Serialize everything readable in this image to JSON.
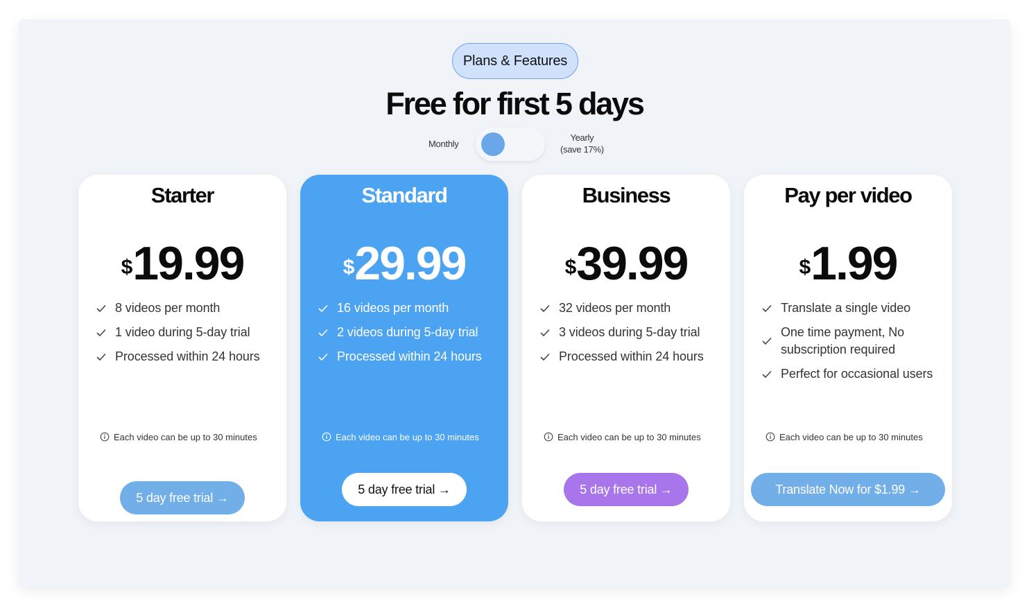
{
  "badge": "Plans & Features",
  "headline": "Free for first 5 days",
  "billing": {
    "monthly_label": "Monthly",
    "yearly_label": "Yearly",
    "yearly_note": "(save 17%)",
    "selected": "Monthly"
  },
  "colors": {
    "page_bg": "#f0f3f7",
    "accent_blue": "#4ba3f2",
    "button_blue": "#72aee8",
    "button_purple": "#a876ea",
    "badge_bg": "#cfe1fb"
  },
  "plans": [
    {
      "name": "Starter",
      "currency": "$",
      "price": "19.99",
      "features": [
        "8 videos per month",
        "1 video during  5-day trial",
        "Processed within 24 hours"
      ],
      "note": "Each video can be up to 30 minutes",
      "button": "5 day free trial →"
    },
    {
      "name": "Standard",
      "currency": "$",
      "price": "29.99",
      "features": [
        "16 videos per month",
        "2 videos during 5-day trial",
        "Processed within 24 hours"
      ],
      "note": "Each video can be up to 30 minutes",
      "button": "5 day free trial →"
    },
    {
      "name": "Business",
      "currency": "$",
      "price": "39.99",
      "features": [
        "32 videos per month",
        "3 videos during 5-day trial",
        "Processed within 24 hours"
      ],
      "note": "Each video can be up to 30 minutes",
      "button": "5 day free trial →"
    },
    {
      "name": "Pay per video",
      "currency": "$",
      "price": "1.99",
      "features": [
        "Translate a single video",
        "One time payment, No subscription required",
        "Perfect for occasional users"
      ],
      "note": "Each video can be up to 30 minutes",
      "button": "Translate Now for $1.99 →"
    }
  ]
}
